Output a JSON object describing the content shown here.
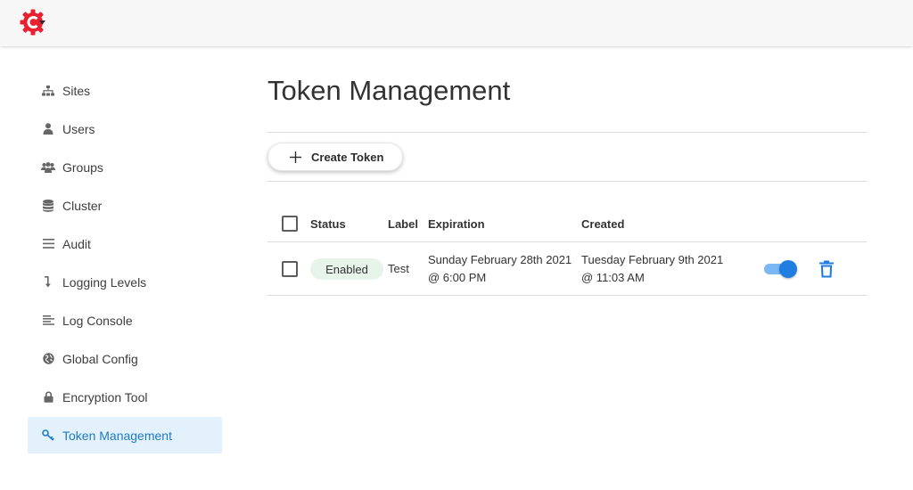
{
  "app": {
    "logo_icon": "cog-c-logo",
    "brand_color": "#e8202f"
  },
  "sidebar": {
    "items": [
      {
        "label": "Sites",
        "icon": "sitemap-icon"
      },
      {
        "label": "Users",
        "icon": "user-icon"
      },
      {
        "label": "Groups",
        "icon": "users-icon"
      },
      {
        "label": "Cluster",
        "icon": "database-icon"
      },
      {
        "label": "Audit",
        "icon": "list-icon"
      },
      {
        "label": "Logging Levels",
        "icon": "level-down-icon"
      },
      {
        "label": "Log Console",
        "icon": "align-left-icon"
      },
      {
        "label": "Global Config",
        "icon": "globe-icon"
      },
      {
        "label": "Encryption Tool",
        "icon": "lock-icon"
      },
      {
        "label": "Token Management",
        "icon": "key-icon",
        "active": true
      }
    ],
    "active_color": "#1f7ac6",
    "active_bg": "#e3f1fd"
  },
  "main": {
    "title": "Token Management",
    "create_button_label": "Create Token",
    "table": {
      "headers": [
        "Status",
        "Label",
        "Expiration",
        "Created"
      ],
      "rows": [
        {
          "status": "Enabled",
          "label": "Test",
          "expiration_line1": "Sunday February 28th 2021",
          "expiration_line2": "@ 6:00 PM",
          "created_line1": "Tuesday February 9th 2021",
          "created_line2": "@ 11:03 AM",
          "enabled": true
        }
      ]
    }
  }
}
